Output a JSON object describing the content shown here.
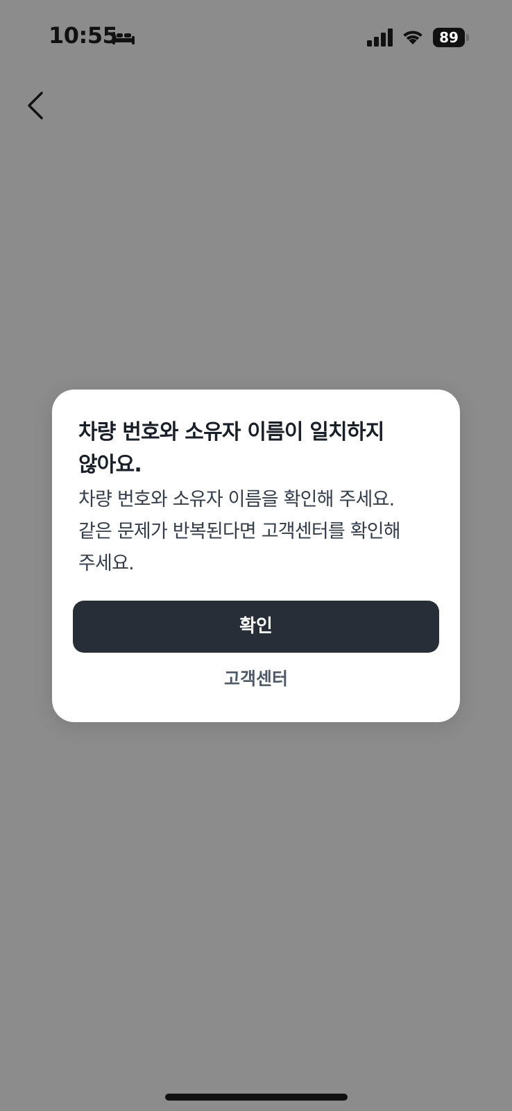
{
  "status_bar": {
    "time": "10:55",
    "battery_level": "89",
    "icons": [
      "sleep-focus-icon",
      "cellular-signal-icon",
      "wifi-icon",
      "battery-icon"
    ]
  },
  "nav": {
    "back_icon": "chevron-left-icon"
  },
  "dialog": {
    "title": "차량 번호와 소유자 이름이 일치하지\n않아요.",
    "body": "차량 번호와 소유자 이름을 확인해 주세요.\n같은 문제가 반복된다면 고객센터를 확인해\n주세요.",
    "confirm_label": "확인",
    "support_label": "고객센터"
  },
  "colors": {
    "backdrop": "#8c8c8c",
    "dialog_bg": "#ffffff",
    "primary_button": "#282e38",
    "title_text": "#191f28",
    "secondary_text": "#4e5968"
  }
}
